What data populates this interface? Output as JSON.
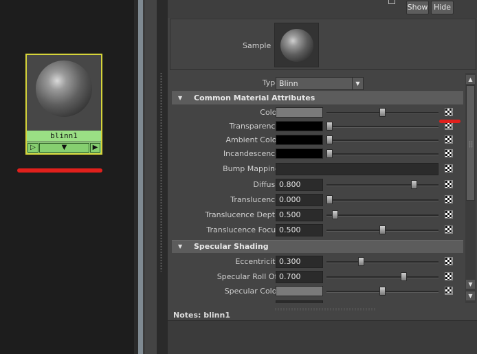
{
  "node": {
    "name": "blinn1",
    "port_in": "▷",
    "port_mid": "▼",
    "port_out": "▶"
  },
  "toolbar": {
    "show_label": "Show",
    "hide_label": "Hide"
  },
  "sample": {
    "label": "Sample"
  },
  "type": {
    "label": "Type",
    "value": "Blinn"
  },
  "sections": {
    "common": {
      "title": "Common Material Attributes"
    },
    "specular": {
      "title": "Specular Shading"
    }
  },
  "attrs": {
    "color": {
      "label": "Color",
      "swatch": "#7a7a7a",
      "level": 0.5
    },
    "transparency": {
      "label": "Transparency",
      "swatch": "#000000",
      "level": 0.0
    },
    "ambient": {
      "label": "Ambient Color",
      "swatch": "#000000",
      "level": 0.0
    },
    "incandescence": {
      "label": "Incandescence",
      "swatch": "#000000",
      "level": 0.0
    },
    "bump": {
      "label": "Bump Mapping"
    },
    "diffuse": {
      "label": "Diffuse",
      "value": "0.800",
      "level": 0.8
    },
    "translucence": {
      "label": "Translucence",
      "value": "0.000",
      "level": 0.0
    },
    "translucence_depth": {
      "label": "Translucence Depth",
      "value": "0.500",
      "level": 0.05
    },
    "translucence_focus": {
      "label": "Translucence Focus",
      "value": "0.500",
      "level": 0.5
    },
    "eccentricity": {
      "label": "Eccentricity",
      "value": "0.300",
      "level": 0.3
    },
    "specular_rolloff": {
      "label": "Specular Roll Off",
      "value": "0.700",
      "level": 0.7
    },
    "specular_color": {
      "label": "Specular Color",
      "swatch": "#7a7a7a",
      "level": 0.5
    }
  },
  "notes": {
    "label": "Notes:  blinn1"
  },
  "colors": {
    "annotation_red": "#e0201c",
    "node_green": "#9adf84",
    "node_border": "#d6d43a"
  }
}
